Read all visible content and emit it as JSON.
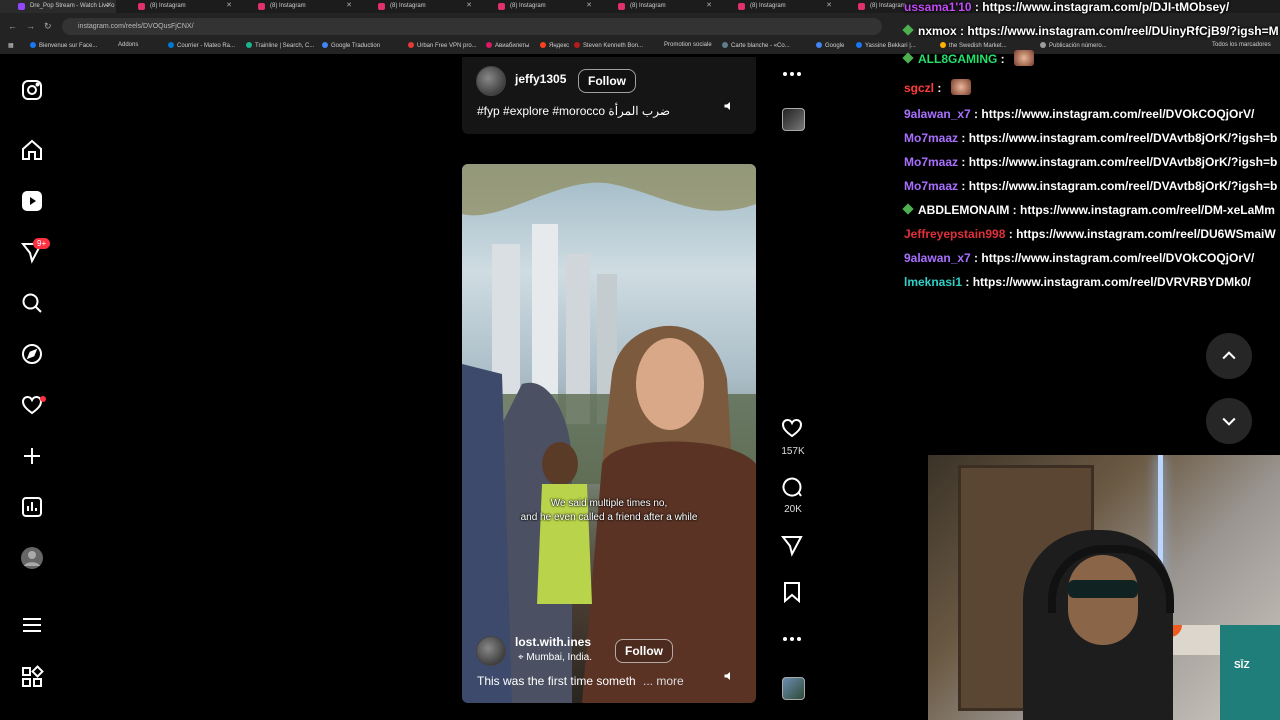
{
  "browser": {
    "tabs": [
      {
        "title": "Dre_Pop Stream - Watch Live o"
      },
      {
        "title": "(8) Instagram"
      },
      {
        "title": "(8) Instagram"
      },
      {
        "title": "(8) Instagram"
      },
      {
        "title": "(8) Instagram"
      },
      {
        "title": "(8) Instagram"
      },
      {
        "title": "(8) Instagram"
      },
      {
        "title": "(8) Instagram"
      }
    ],
    "url": "instagram.com/reels/DVOQusFjCNX/",
    "bookmarks": [
      "Bienvenue sur Face...",
      "Addons",
      "Courrier - Mateo Ra...",
      "Trainline | Search, C...",
      "Google Traduction",
      "Urban Free VPN pro...",
      "Авиабилеты",
      "Яндекс",
      "Steven Kenneth Bon...",
      "Promotion sociale",
      "Carte blanche - «Co...",
      "Google",
      "Yassine Bekkari |...",
      "the Swedish Market...",
      "Publicación número...",
      "Todos los marcadores"
    ]
  },
  "sidebar": {
    "notification_badge": "9+"
  },
  "reel_top": {
    "username": "jeffy1305",
    "follow_label": "Follow",
    "caption": "#fyp #explore #morocco ضرب المرأة"
  },
  "reel_main": {
    "username": "lost.with.ines",
    "follow_label": "Follow",
    "location": "Mumbai, India.",
    "caption": "This was the first time someth",
    "more_label": "... more",
    "subtitle_line1": "We said multiple times no,",
    "subtitle_line2": "and he even called a friend after a while",
    "likes": "157K",
    "comments": "20K"
  },
  "chat": {
    "messages": [
      {
        "user": "ussama1'10",
        "color": "#c24cf6",
        "text": "https://www.instagram.com/p/DJI-tMObsey/",
        "gem": false
      },
      {
        "user": "nxmox",
        "color": "#ffffff",
        "text": "https://www.instagram.com/reel/DUinyRfCjB9/?igsh=M",
        "gem": true
      },
      {
        "user": "ALL8GAMING",
        "color": "#22e06b",
        "text": "",
        "gem": true,
        "emote": true
      },
      {
        "user": "sgczl",
        "color": "#ff3b3b",
        "text": "",
        "gem": false,
        "emote": true
      },
      {
        "user": "9alawan_x7",
        "color": "#a970ff",
        "text": "https://www.instagram.com/reel/DVOkCOQjOrV/",
        "gem": false
      },
      {
        "user": "Mo7maaz",
        "color": "#a970ff",
        "text": "https://www.instagram.com/reel/DVAvtb8jOrK/?igsh=b",
        "gem": false
      },
      {
        "user": "Mo7maaz",
        "color": "#a970ff",
        "text": "https://www.instagram.com/reel/DVAvtb8jOrK/?igsh=b",
        "gem": false
      },
      {
        "user": "Mo7maaz",
        "color": "#a970ff",
        "text": "https://www.instagram.com/reel/DVAvtb8jOrK/?igsh=b",
        "gem": false
      },
      {
        "user": "ABDLEMONAIM",
        "color": "#ffffff",
        "text": "https://www.instagram.com/reel/DM-xeLaMm",
        "gem": true
      },
      {
        "user": "Jeffreyepstain998",
        "color": "#e0303a",
        "text": "https://www.instagram.com/reel/DU6WSmaiW",
        "gem": false
      },
      {
        "user": "9alawan_x7",
        "color": "#a970ff",
        "text": "https://www.instagram.com/reel/DVOkCOQjOrV/",
        "gem": false
      },
      {
        "user": "lmeknasi1",
        "color": "#2ed0c8",
        "text": "https://www.instagram.com/reel/DVRVRBYDMk0/",
        "gem": false
      }
    ]
  },
  "webcam": {
    "chair_label": "SĪZ"
  },
  "colors": {
    "background": "#000000",
    "badge": "#ff3040",
    "chat_gem": "#4caf50"
  }
}
